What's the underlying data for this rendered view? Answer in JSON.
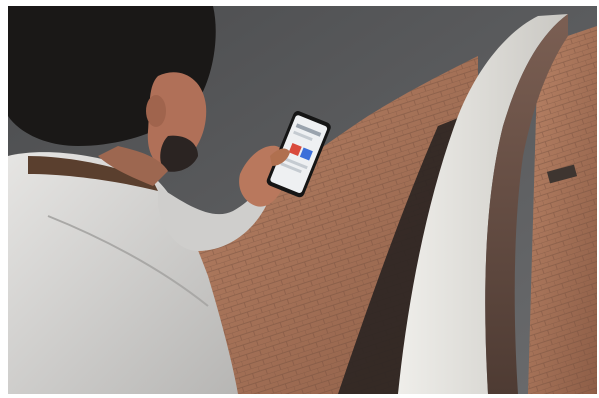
{
  "photo": {
    "scene": "street-photo",
    "palette": {
      "asphalt": "#5b5c5e",
      "brick": "#a5745a",
      "concrete": "#d8d6d2",
      "jacket": "#d9d8d6",
      "hair": "#1a1817",
      "skin": "#b9785d",
      "shadow": "#2b2625",
      "phone_screen": "#eef0f2"
    }
  }
}
